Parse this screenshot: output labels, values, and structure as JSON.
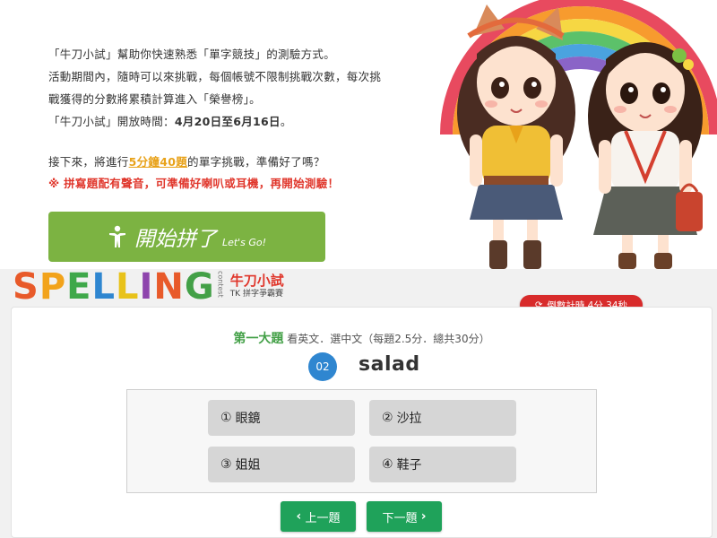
{
  "intro": {
    "line1": "「牛刀小試」幫助你快速熟悉「單字競技」的測驗方式。",
    "line2": "活動期間內，隨時可以來挑戰，每個帳號不限制挑戰次數，每次挑",
    "line3": "戰獲得的分數將累積計算進入「榮譽榜」。",
    "line4_prefix": "「牛刀小試」開放時間：",
    "line4_dates": "4月20日至6月16日",
    "line4_suffix": "。"
  },
  "challenge": {
    "prefix": "接下來，將進行",
    "highlight": "5分鐘40題",
    "suffix": "的單字挑戰，準備好了嗎？"
  },
  "warning": "※ 拼寫題配有聲音，可準備好喇叭或耳機，再開始測驗！",
  "start_button": {
    "label": "開始拼了",
    "sub": "Let's Go!"
  },
  "logo": {
    "letters": [
      "S",
      "P",
      "E",
      "L",
      "L",
      "I",
      "N",
      "G"
    ],
    "colors": [
      "#e85a2a",
      "#f2a31b",
      "#3fa84a",
      "#2f86d0",
      "#e8c21a",
      "#8e44ad",
      "#e85a2a",
      "#43a047"
    ],
    "contest": "contest",
    "brand_cn": "牛刀小試",
    "brand_en": "TK 拼字爭霸賽"
  },
  "timer": {
    "label": "倒數計時 4分 34秒"
  },
  "quiz": {
    "section_big": "第一大題",
    "section_small": " 看英文．選中文（每題2.5分．總共30分）",
    "number": "02",
    "word": "salad",
    "options": [
      {
        "num": "①",
        "text": "眼鏡"
      },
      {
        "num": "②",
        "text": "沙拉"
      },
      {
        "num": "③",
        "text": "姐姐"
      },
      {
        "num": "④",
        "text": "鞋子"
      }
    ]
  },
  "nav": {
    "prev": "上一題",
    "next": "下一題"
  },
  "colors": {
    "start_green": "#7cb342",
    "nav_green": "#1fa25a",
    "timer_red": "#d82b2b",
    "qnum_blue": "#2f86d0",
    "section_green": "#43a047",
    "warning_red": "#e0362b",
    "highlight_orange": "#e8a21a"
  }
}
